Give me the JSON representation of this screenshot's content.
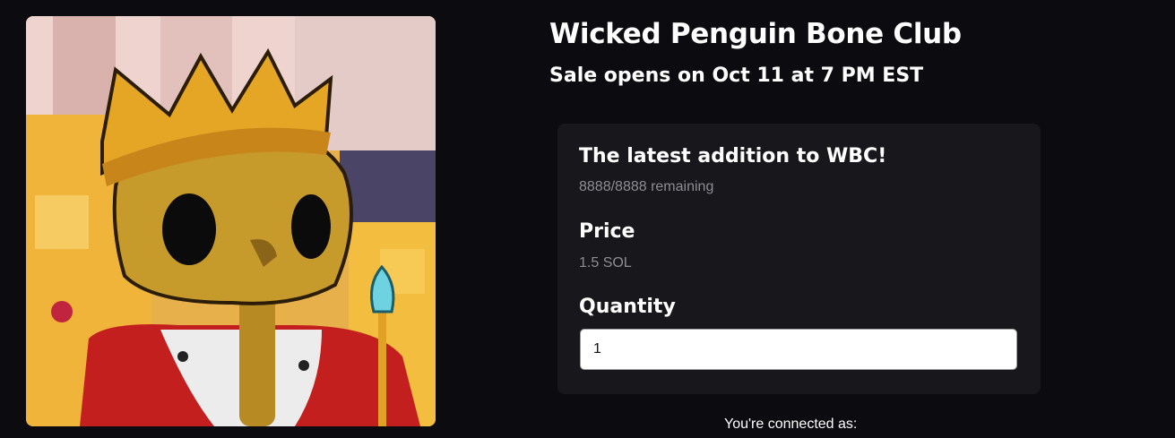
{
  "collection": {
    "title": "Wicked Penguin Bone Club",
    "sale_opens": "Sale opens on Oct 11 at 7 PM EST",
    "image_alt": "crowned skeleton penguin artwork"
  },
  "mint_card": {
    "headline": "The latest addition to WBC!",
    "remaining": "8888/8888 remaining",
    "price_label": "Price",
    "price_value": "1.5 SOL",
    "quantity_label": "Quantity",
    "quantity_value": "1"
  },
  "wallet": {
    "connected_label": "You're connected as:"
  }
}
